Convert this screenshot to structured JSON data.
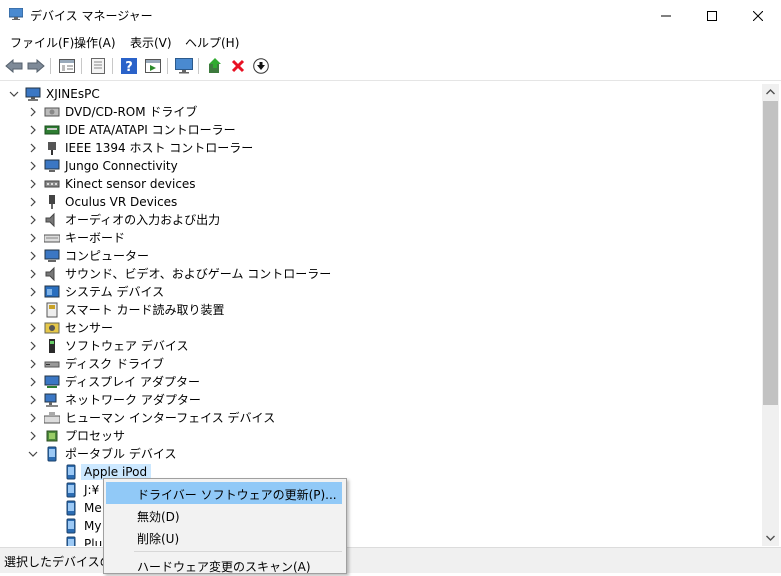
{
  "window": {
    "title": "デバイス マネージャー"
  },
  "menu": [
    "ファイル(F)",
    "操作(A)",
    "表示(V)",
    "ヘルプ(H)"
  ],
  "tree": {
    "root": "XJINEsPC",
    "categories": [
      {
        "label": "DVD/CD-ROM ドライブ",
        "icon": "dvd-drive-icon"
      },
      {
        "label": "IDE ATA/ATAPI コントローラー",
        "icon": "ide-controller-icon"
      },
      {
        "label": "IEEE 1394 ホスト コントローラー",
        "icon": "ieee1394-icon"
      },
      {
        "label": "Jungo Connectivity",
        "icon": "monitor-device-icon"
      },
      {
        "label": "Kinect sensor devices",
        "icon": "kinect-icon"
      },
      {
        "label": "Oculus VR Devices",
        "icon": "usb-plug-icon"
      },
      {
        "label": "オーディオの入力および出力",
        "icon": "speaker-icon"
      },
      {
        "label": "キーボード",
        "icon": "keyboard-icon"
      },
      {
        "label": "コンピューター",
        "icon": "computer-icon"
      },
      {
        "label": "サウンド、ビデオ、およびゲーム コントローラー",
        "icon": "speaker-icon"
      },
      {
        "label": "システム デバイス",
        "icon": "system-device-icon"
      },
      {
        "label": "スマート カード読み取り装置",
        "icon": "smart-card-icon"
      },
      {
        "label": "センサー",
        "icon": "sensor-icon"
      },
      {
        "label": "ソフトウェア デバイス",
        "icon": "software-device-icon"
      },
      {
        "label": "ディスク ドライブ",
        "icon": "disk-drive-icon"
      },
      {
        "label": "ディスプレイ アダプター",
        "icon": "display-adapter-icon"
      },
      {
        "label": "ネットワーク アダプター",
        "icon": "network-adapter-icon"
      },
      {
        "label": "ヒューマン インターフェイス デバイス",
        "icon": "hid-icon"
      },
      {
        "label": "プロセッサ",
        "icon": "processor-icon"
      },
      {
        "label": "ポータブル デバイス",
        "icon": "portable-device-icon",
        "expanded": true
      }
    ],
    "portable_children": [
      "Apple iPod",
      "J:¥",
      "Me",
      "My",
      "Plu"
    ]
  },
  "context_menu": {
    "items": [
      "ドライバー ソフトウェアの更新(P)...",
      "無効(D)",
      "削除(U)",
      "ハードウェア変更のスキャン(A)"
    ]
  },
  "status": {
    "text": "選択したデバイスのド"
  },
  "colors": {
    "selection": "#cce8ff",
    "menu_highlight": "#91c9f7",
    "delete_red": "#e81123"
  }
}
